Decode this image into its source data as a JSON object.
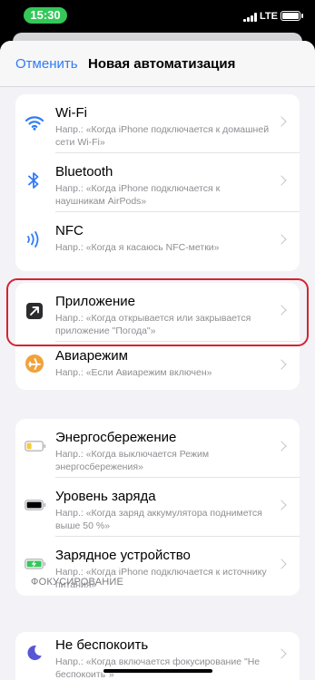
{
  "status_bar": {
    "time": "15:30",
    "network": "LTE"
  },
  "nav": {
    "cancel_label": "Отменить",
    "title": "Новая автоматизация"
  },
  "groups": {
    "connectivity": [
      {
        "icon": "wifi-icon",
        "title": "Wi‑Fi",
        "subtitle": "Напр.: «Когда iPhone подключается к домашней сети Wi‑Fi»"
      },
      {
        "icon": "bluetooth-icon",
        "title": "Bluetooth",
        "subtitle": "Напр.: «Когда iPhone подключается к наушникам AirPods»"
      },
      {
        "icon": "nfc-icon",
        "title": "NFC",
        "subtitle": "Напр.: «Когда я касаюсь NFC‑метки»"
      }
    ],
    "apps": [
      {
        "icon": "app-open-icon",
        "title": "Приложение",
        "subtitle": "Напр.: «Когда открывается или закрывается приложение \"Погода\"»"
      },
      {
        "icon": "airplane-icon",
        "title": "Авиарежим",
        "subtitle": "Напр.: «Если Авиарежим включен»"
      }
    ],
    "power": [
      {
        "icon": "low-power-battery-icon",
        "title": "Энергосбережение",
        "subtitle": "Напр.: «Когда выключается Режим энергосбережения»"
      },
      {
        "icon": "battery-level-icon",
        "title": "Уровень заряда",
        "subtitle": "Напр.: «Когда заряд аккумулятора поднимется выше 50 %»"
      },
      {
        "icon": "charger-icon",
        "title": "Зарядное устройство",
        "subtitle": "Напр.: «Когда iPhone подключается к источнику питания»"
      }
    ],
    "focus_header": "ФОКУСИРОВАНИЕ",
    "focus": [
      {
        "icon": "moon-icon",
        "title": "Не беспокоить",
        "subtitle": "Напр.: «Когда включается фокусирование \"Не беспокоить\"»"
      }
    ]
  },
  "colors": {
    "accent": "#2f7bf5",
    "highlight": "#d7222f",
    "airplane": "#f0a23a",
    "low_power": "#f5cb3c",
    "charging": "#34c759",
    "moon": "#5856d6"
  }
}
